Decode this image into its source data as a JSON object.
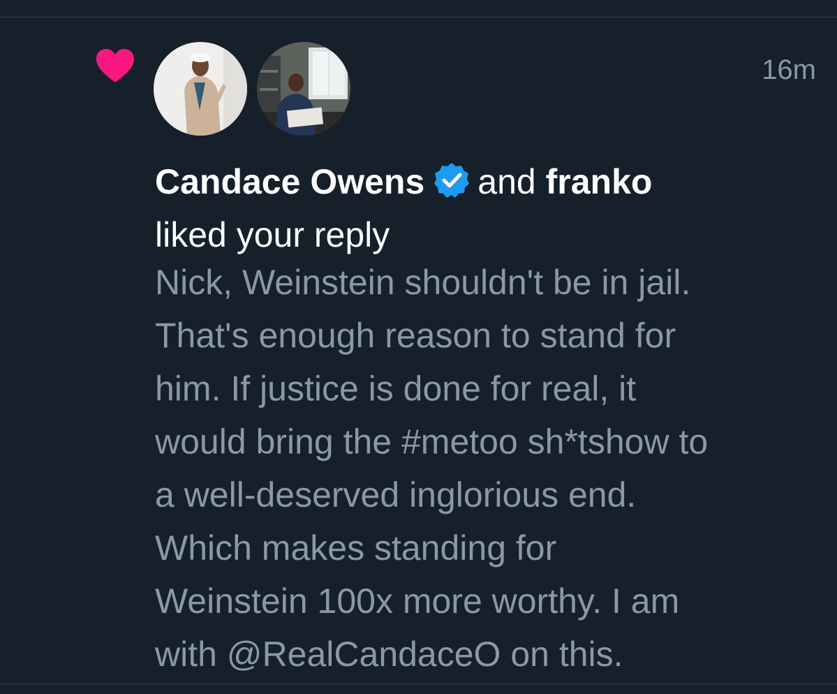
{
  "notification": {
    "timestamp": "16m",
    "user1_name": "Candace Owens",
    "conjunction": "and",
    "user2_name": "franko",
    "action": "liked your reply",
    "icons": {
      "type": "heart-icon",
      "verified": "verified-badge-icon"
    },
    "colors": {
      "heart": "#f91880",
      "verified": "#1d9bf0",
      "background": "#15202b",
      "muted_text": "#8b98a5"
    }
  },
  "reply": {
    "lines": [
      "Nick, Weinstein shouldn't be in jail.",
      "That's enough reason to stand for",
      "him. If justice is done for real, it",
      "would bring the #metoo sh*tshow to",
      "a well-deserved inglorious end.",
      "Which makes standing for",
      "Weinstein 100x more worthy. I am",
      "with @RealCandaceO on this."
    ]
  }
}
